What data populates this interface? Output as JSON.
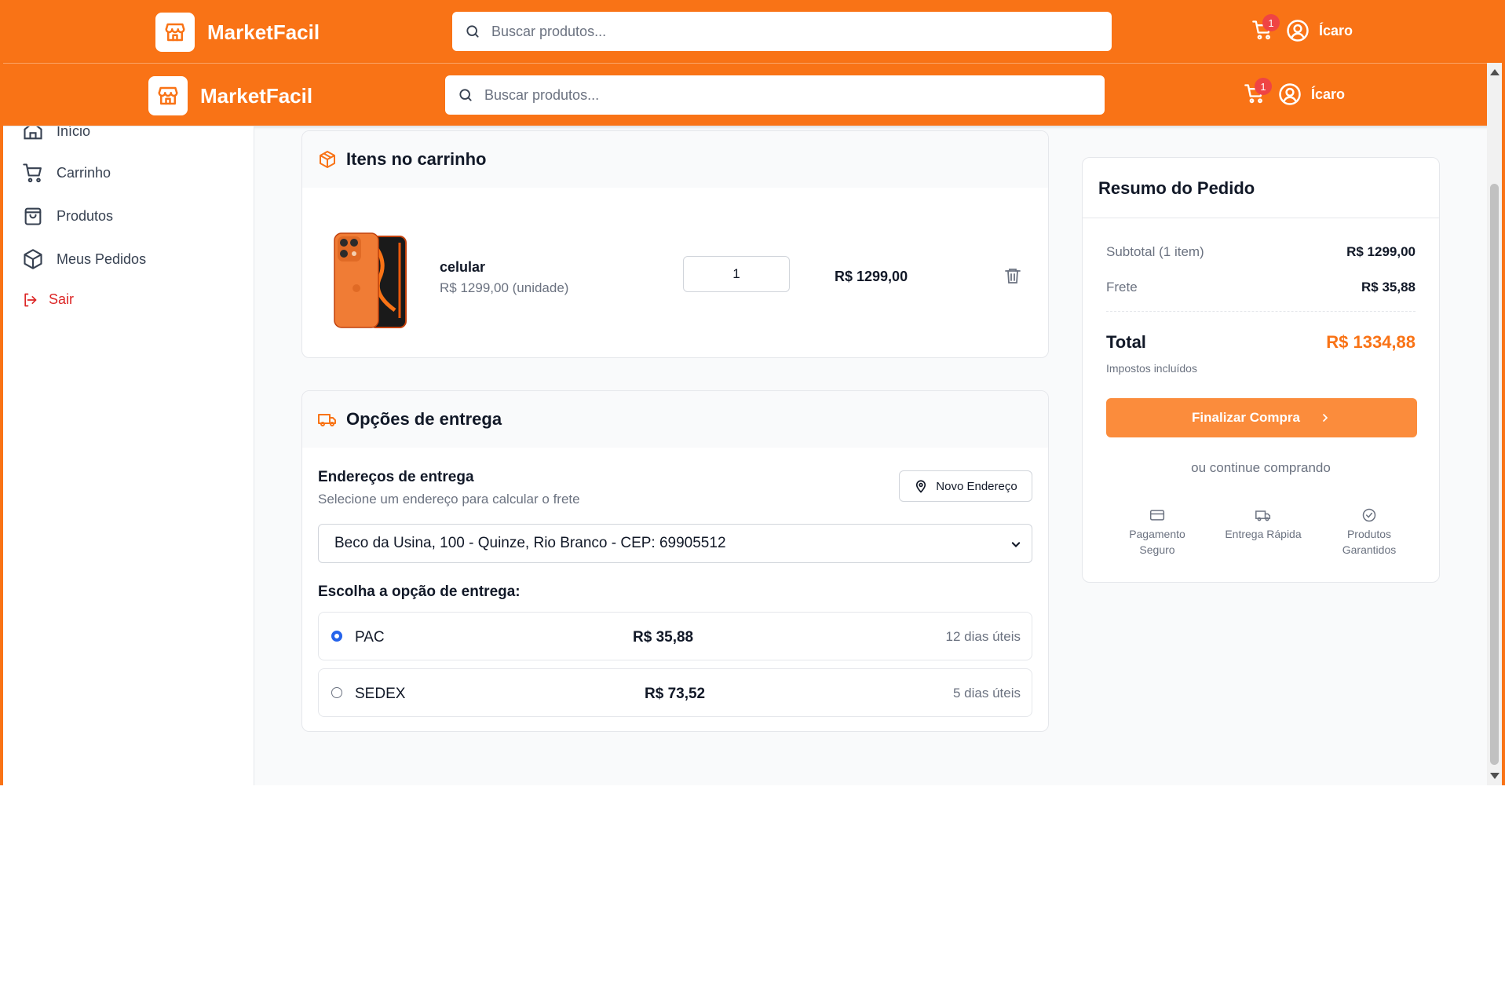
{
  "brand": {
    "name": "MarketFacil"
  },
  "search": {
    "placeholder": "Buscar produtos..."
  },
  "cart": {
    "badge": "1"
  },
  "user": {
    "name": "Ícaro"
  },
  "sidebar": {
    "items": [
      {
        "label": "Início",
        "icon": "home-icon"
      },
      {
        "label": "Carrinho",
        "icon": "cart-icon"
      },
      {
        "label": "Produtos",
        "icon": "bag-icon"
      },
      {
        "label": "Meus Pedidos",
        "icon": "box-icon"
      },
      {
        "label": "Sair",
        "icon": "logout-icon"
      }
    ]
  },
  "cart_items": {
    "title": "Itens no carrinho",
    "item": {
      "name": "celular",
      "unit_price": "R$ 1299,00 (unidade)",
      "quantity": "1",
      "total": "R$ 1299,00"
    }
  },
  "delivery": {
    "title": "Opções de entrega",
    "addresses_title": "Endereços de entrega",
    "addresses_desc": "Selecione um endereço para calcular o frete",
    "new_address": "Novo Endereço",
    "selected_address": "Beco da Usina, 100 - Quinze, Rio Branco - CEP: 69905512",
    "choose_label": "Escolha a opção de entrega:",
    "options": [
      {
        "name": "PAC",
        "price": "R$ 35,88",
        "days": "12 dias úteis",
        "selected": true
      },
      {
        "name": "SEDEX",
        "price": "R$ 73,52",
        "days": "5 dias úteis",
        "selected": false
      }
    ]
  },
  "summary": {
    "title": "Resumo do Pedido",
    "subtotal_label": "Subtotal (1 item)",
    "subtotal_value": "R$ 1299,00",
    "shipping_label": "Frete",
    "shipping_value": "R$ 35,88",
    "total_label": "Total",
    "total_value": "R$ 1334,88",
    "taxes_note": "Impostos incluídos",
    "finish_button": "Finalizar Compra",
    "continue_link": "ou continue comprando",
    "features": [
      {
        "label": "Pagamento Seguro",
        "icon": "card-icon"
      },
      {
        "label": "Entrega Rápida",
        "icon": "truck-icon"
      },
      {
        "label": "Produtos Garantidos",
        "icon": "check-circle-icon"
      }
    ]
  },
  "colors": {
    "primary": "#f97316",
    "button": "#fb8c3c",
    "danger": "#dc2626",
    "badge": "#ef4444"
  }
}
